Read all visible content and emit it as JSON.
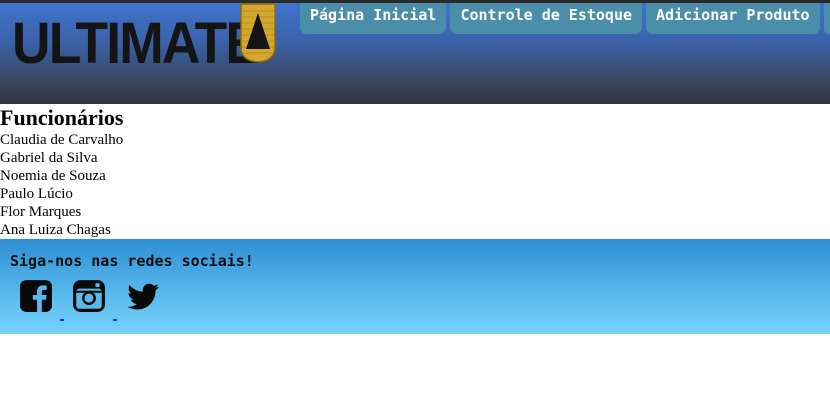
{
  "header": {
    "logo_text": "ULTIMATE",
    "nav": [
      {
        "label": "Página Inicial"
      },
      {
        "label": "Controle de Estoque"
      },
      {
        "label": "Adicionar Produto"
      }
    ]
  },
  "main": {
    "title": "Funcionários",
    "employees": [
      "Claudia de Carvalho",
      "Gabriel da Silva",
      "Noemia de Souza",
      "Paulo Lúcio",
      "Flor Marques",
      "Ana Luiza Chagas"
    ]
  },
  "footer": {
    "text": "Siga-nos nas redes sociais!",
    "social_icons": [
      "facebook-icon",
      "instagram-icon",
      "twitter-icon"
    ]
  },
  "colors": {
    "header_top": "#3f74cc",
    "header_bottom": "#33353d",
    "nav_bg": "#4b8eaa",
    "footer_top": "#2e8ed4",
    "footer_bottom": "#76d2fb",
    "logo_gold": "#d4a82e"
  }
}
